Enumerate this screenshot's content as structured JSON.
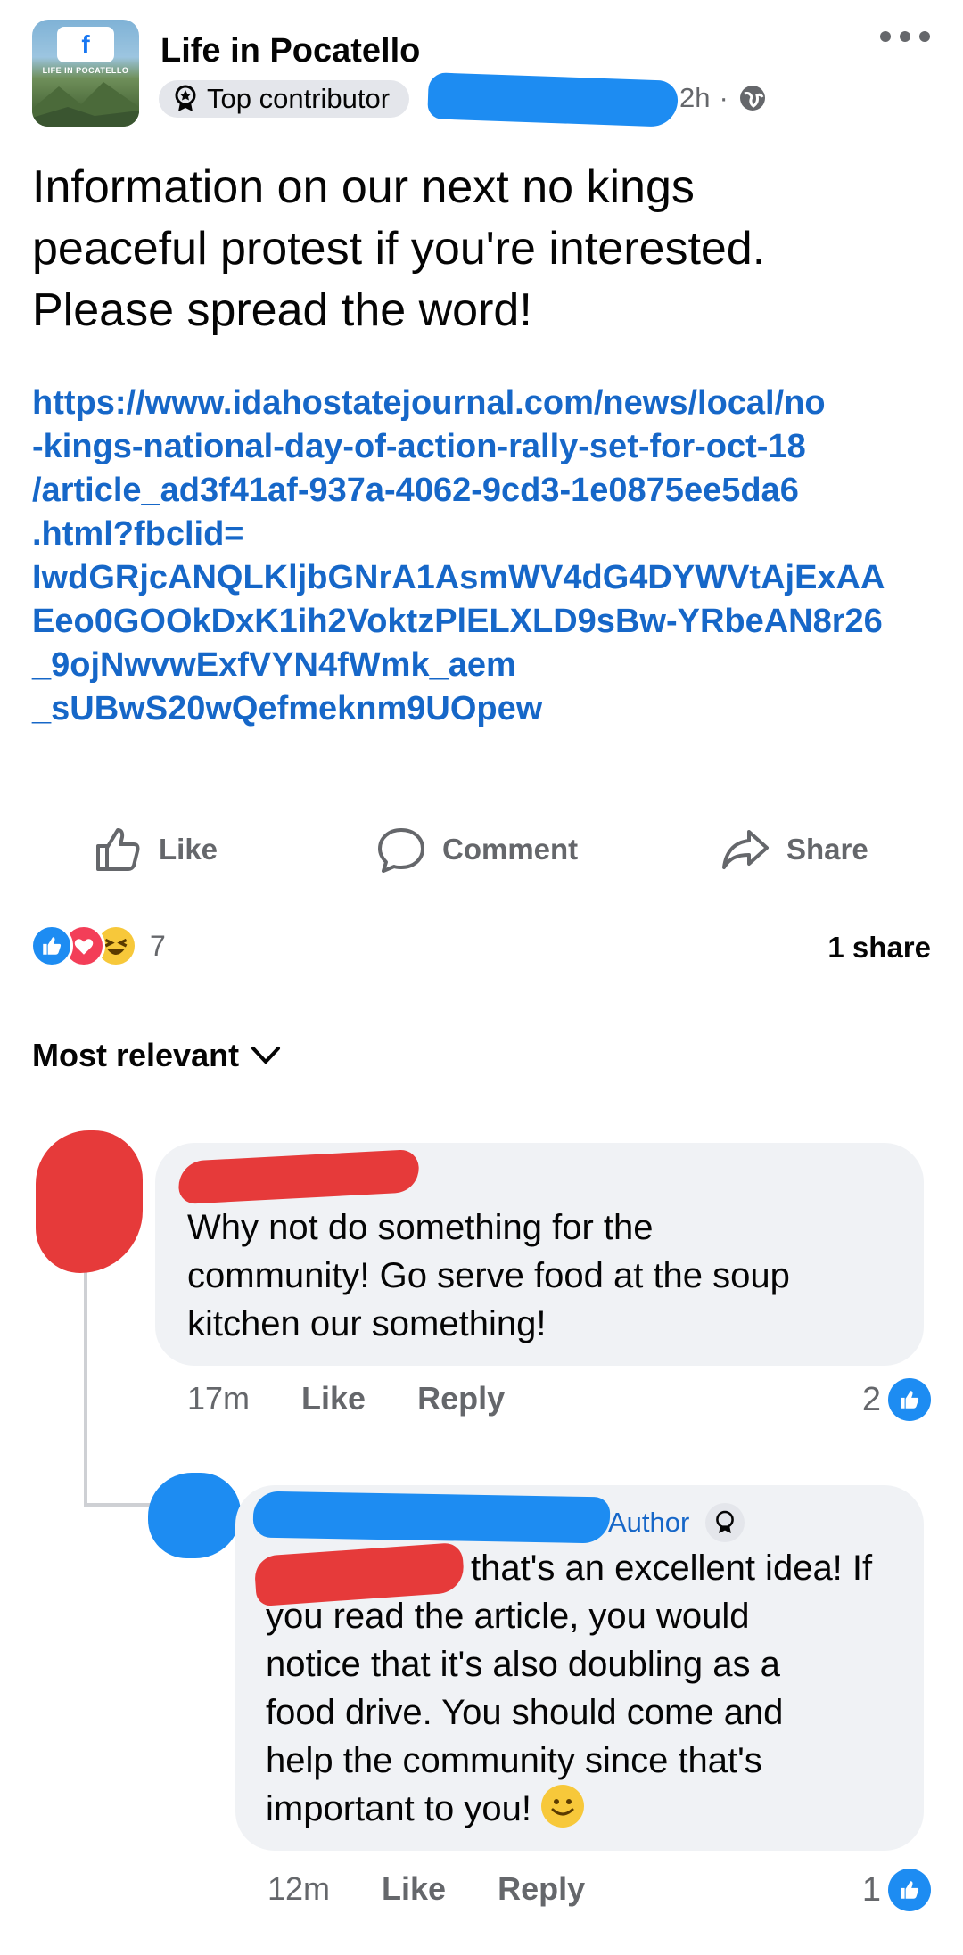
{
  "header": {
    "group_name": "Life in Pocatello",
    "avatar_logo_text": "LIFE IN POCATELLO",
    "badge_label": "Top contributor",
    "timestamp": "2h",
    "audience_icon": "globe-icon",
    "more_icon": "more-dots-icon"
  },
  "post": {
    "text": "Information on our next no kings\npeaceful protest if you're interested.\nPlease spread the word!",
    "link": "https://www.idahostatejournal.com/news/local/no\n-kings-national-day-of-action-rally-set-for-oct-18\n/article_ad3f41af-937a-4062-9cd3-1e0875ee5da6\n.html?fbclid=\nIwdGRjcANQLKljbGNrA1AsmWV4dG4DYWVtAjExAA\nEeo0GOOkDxK1ih2VoktzPlELXLD9sBw-YRbeAN8r26\n_9ojNwvwExfVYN4fWmk_aem\n_sUBwS20wQefmeknm9UOpew"
  },
  "actions": {
    "like_label": "Like",
    "comment_label": "Comment",
    "share_label": "Share"
  },
  "reactions": {
    "types": [
      "like",
      "love",
      "haha"
    ],
    "count": "7",
    "shares": "1 share"
  },
  "sort": {
    "label": "Most relevant"
  },
  "comments": [
    {
      "text": "Why not do something for the\ncommunity! Go serve food at the soup\nkitchen our something!",
      "time": "17m",
      "like_label": "Like",
      "reply_label": "Reply",
      "likes": "2"
    },
    {
      "author_badge": "Author",
      "text": "that's an excellent idea! If\nyou read the article, you would\nnotice that it's also doubling as a\nfood drive. You should come and\nhelp the community since that's\nimportant to you!",
      "time": "12m",
      "like_label": "Like",
      "reply_label": "Reply",
      "likes": "1"
    }
  ],
  "colors": {
    "link": "#1667c8",
    "like_blue": "#1d8cf2",
    "love_red": "#f33e58",
    "haha_yellow": "#f7c83a",
    "redaction_red": "#e63a3a",
    "redaction_blue": "#1d8cf2",
    "bubble_bg": "#f0f2f5",
    "meta_gray": "#65676b"
  }
}
